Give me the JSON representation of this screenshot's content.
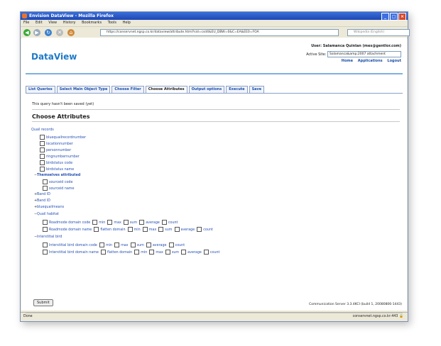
{
  "window": {
    "title": "Envision DataView - Mozilla Firefox",
    "menu": [
      "File",
      "Edit",
      "View",
      "History",
      "Bookmarks",
      "Tools",
      "Help"
    ],
    "url": "https://conservnet.ngsp.co.kr/dataview/attribute.html?sid=csd4&EU_DBW=0&C=EA&EE0=FOA",
    "search_placeholder": "Wikipedia (English)"
  },
  "header": {
    "logo": "DataView",
    "user_line": "User: Salamanca Quinlan (mes@gentlor.com)",
    "active_site_label": "Active Site:",
    "active_site_value": "Salamanca&amp;2007 attachment",
    "links": [
      "Home",
      "Applications",
      "Logout"
    ]
  },
  "tabs": [
    "List Queries",
    "Select Main Object Type",
    "Choose Filter",
    "Choose Attributes",
    "Output options",
    "Execute",
    "Save"
  ],
  "notice": "This query hasn't been saved (yet)",
  "section_title": "Choose Attributes",
  "tree": {
    "root": "Quail records",
    "group1": [
      "bluequailrecordnumber",
      "locationnumber",
      "personnumber",
      "ringnumbernumber",
      "birdstatus code",
      "birdstatus name"
    ],
    "subgroup_label": "Themselves attributed",
    "subgroup_items": [
      "sourceid code",
      "sourceid name"
    ],
    "collapsed": [
      "Band ID",
      "Band ID",
      "bluequailmeans"
    ],
    "group2_label": "Quail habitat",
    "group2_rows": [
      [
        "Roadmode domain code",
        "min",
        "max",
        "sum",
        "average",
        "count"
      ],
      [
        "Roadmode domain name",
        "flatten domain",
        "min",
        "max",
        "sum",
        "average",
        "count"
      ]
    ],
    "group3_label": "Interstitial bird",
    "group3_rows": [
      [
        "Interstitial bird domain code",
        "min",
        "max",
        "sum",
        "average",
        "count"
      ],
      [
        "Interstitial bird domain name",
        "flatten domain",
        "min",
        "max",
        "sum",
        "average",
        "count"
      ]
    ]
  },
  "submit_label": "Submit",
  "footer": "Communication Server 3.3.4KCI (build 1, 20080806-1443)",
  "status": {
    "left": "Done",
    "right": "conservnet.ngsp.co.kr:443"
  },
  "colors": {
    "link": "#2650b4",
    "accent": "#1f7ac8",
    "titlebar": "#1d47b5"
  }
}
